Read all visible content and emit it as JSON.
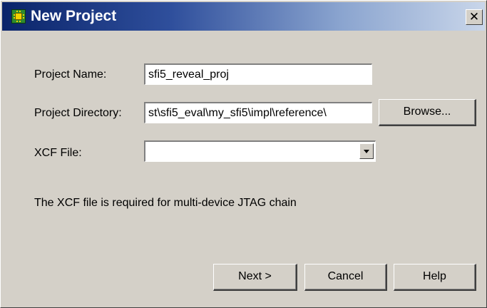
{
  "window": {
    "title": "New Project",
    "icon": "reveal-app-icon",
    "close_glyph": "✕"
  },
  "form": {
    "project_name": {
      "label": "Project Name:",
      "value": "sfi5_reveal_proj"
    },
    "project_directory": {
      "label": "Project Directory:",
      "value": "st\\sfi5_eval\\my_sfi5\\impl\\reference\\",
      "browse_label": "Browse..."
    },
    "xcf_file": {
      "label": "XCF File:",
      "value": ""
    },
    "info_text": "The XCF file is required for multi-device JTAG chain"
  },
  "buttons": {
    "next": "Next >",
    "cancel": "Cancel",
    "help": "Help"
  },
  "colors": {
    "title_gradient_start": "#0a246a",
    "title_gradient_end": "#c9d6ea",
    "dialog_background": "#d4d0c8"
  }
}
